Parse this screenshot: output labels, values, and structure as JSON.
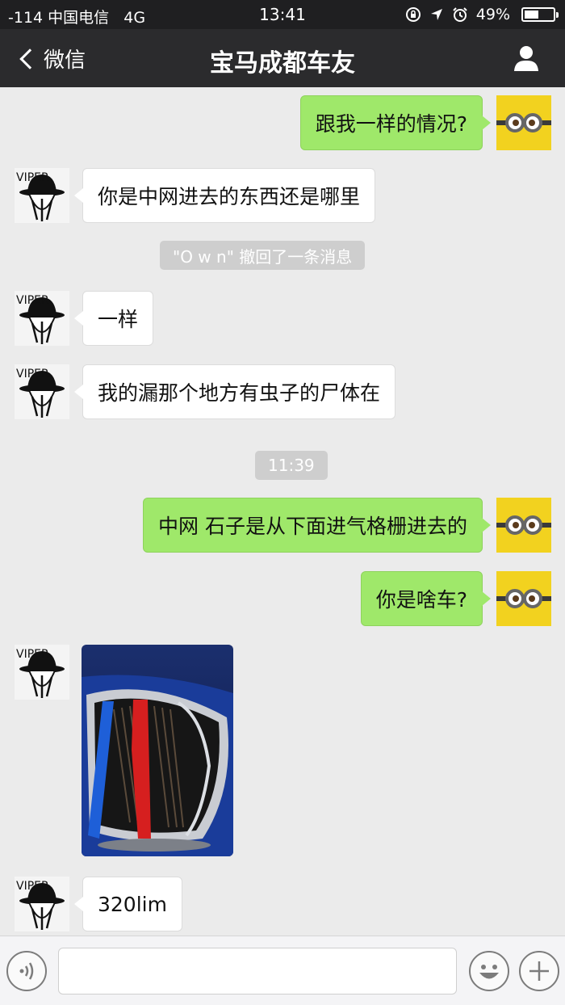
{
  "status_bar": {
    "signal": "-114 中国电信",
    "network": "4G",
    "time": "13:41",
    "battery": "49%",
    "battery_level": 0.49,
    "icons": [
      "lock-rotation-icon",
      "location-arrow-icon",
      "alarm-clock-icon",
      "battery-icon"
    ]
  },
  "nav": {
    "back_label": "微信",
    "title": "宝马成都车友",
    "right_icon": "person-icon"
  },
  "messages": [
    {
      "from": "me",
      "text": "跟我一样的情况?"
    },
    {
      "from": "other",
      "text": "你是中网进去的东西还是哪里"
    },
    {
      "type": "system",
      "text": "\"O w n\" 撤回了一条消息"
    },
    {
      "from": "other",
      "text": "一样"
    },
    {
      "from": "other",
      "text": "我的漏那个地方有虫子的尸体在"
    },
    {
      "type": "time",
      "text": "11:39"
    },
    {
      "from": "me",
      "text": "中网 石子是从下面进气格栅进去的"
    },
    {
      "from": "me",
      "text": "你是啥车?"
    },
    {
      "from": "other",
      "type": "image",
      "text": ""
    },
    {
      "from": "other",
      "text": "320lim"
    }
  ],
  "avatar_other_text": "VIPER",
  "input": {
    "placeholder": "",
    "left_icon": "voice-icon",
    "emoji_icon": "emoji-icon",
    "plus_icon": "plus-icon"
  },
  "colors": {
    "my_bubble": "#9fe86a",
    "other_bubble": "#ffffff",
    "background": "#ebebeb",
    "navbar": "#2b2b2d"
  }
}
